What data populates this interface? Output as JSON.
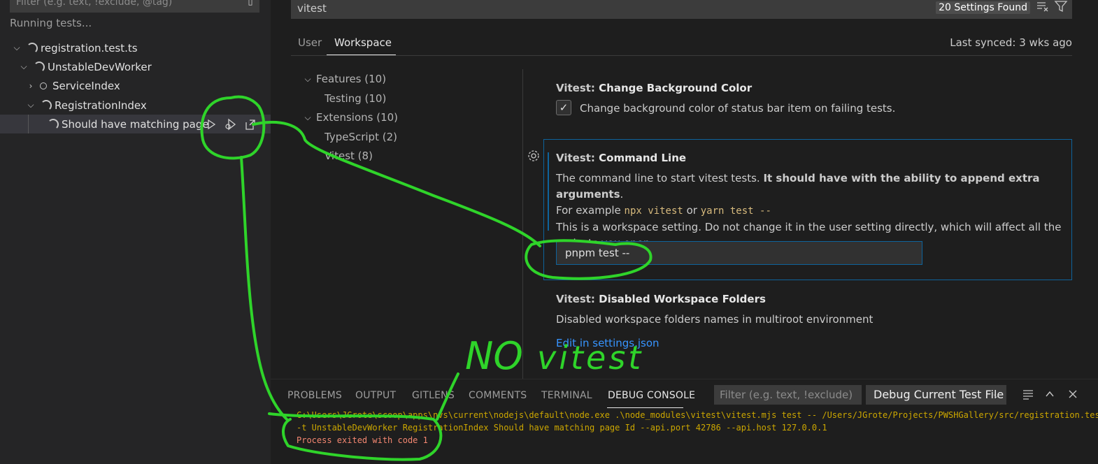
{
  "test_explorer": {
    "filter_placeholder": "Filter (e.g. text, !exclude, @tag)",
    "status": "Running tests...",
    "tree": [
      {
        "label": "registration.test.ts"
      },
      {
        "label": "UnstableDevWorker"
      },
      {
        "label": "ServiceIndex"
      },
      {
        "label": "RegistrationIndex"
      },
      {
        "label": "Should have matching page"
      }
    ],
    "row_actions": [
      "run-test-icon",
      "debug-test-icon",
      "go-to-test-icon"
    ]
  },
  "settings": {
    "search_query": "vitest",
    "found_badge": "20 Settings Found",
    "tabs": [
      {
        "label": "User"
      },
      {
        "label": "Workspace"
      }
    ],
    "active_tab": "Workspace",
    "last_synced": "Last synced: 3 wks ago",
    "toc": [
      {
        "label": "Features (10)"
      },
      {
        "label": "Testing (10)"
      },
      {
        "label": "Extensions (10)"
      },
      {
        "label": "TypeScript (2)"
      },
      {
        "label": "Vitest (8)"
      }
    ],
    "items": [
      {
        "category": "Vitest: ",
        "title": "Change Background Color",
        "checkbox_checked": true,
        "checkbox_label": "Change background color of status bar item on failing tests."
      },
      {
        "category": "Vitest: ",
        "title": "Command Line",
        "desc_plain": "The command line to start vitest tests. ",
        "desc_bold": "It should have with the ability to append extra arguments",
        "desc_end": ".",
        "example_prefix": "For example ",
        "example_code1": "npx vitest",
        "example_or": " or ",
        "example_code2": "yarn test --",
        "note": "This is a workspace setting. Do not change it in the user setting directly, which will affect all the projects you open",
        "value": "pnpm test --"
      },
      {
        "category": "Vitest: ",
        "title": "Disabled Workspace Folders",
        "description": "Disabled workspace folders names in multiroot environment",
        "link": "Edit in settings.json"
      }
    ]
  },
  "panel": {
    "tabs": [
      {
        "label": "PROBLEMS"
      },
      {
        "label": "OUTPUT"
      },
      {
        "label": "GITLENS"
      },
      {
        "label": "COMMENTS"
      },
      {
        "label": "TERMINAL"
      },
      {
        "label": "DEBUG CONSOLE"
      }
    ],
    "active_tab": "DEBUG CONSOLE",
    "filter_placeholder": "Filter (e.g. text, !exclude)",
    "selected_config": "Debug Current Test File",
    "console": [
      "C:\\Users\\JGrote\\scoop\\apps\\nvs\\current\\nodejs\\default\\node.exe .\\node_modules\\vitest\\vitest.mjs test -- /Users/JGrote/Projects/PWSHGallery/src/registration.test.ts",
      "-t UnstableDevWorker RegistrationIndex Should have matching page Id --api.port 42786 --api.host 127.0.0.1",
      "Process exited with code 1"
    ]
  },
  "annotation": {
    "handwritten_text_1": "NO",
    "handwritten_text_2": "vitest",
    "color": "#2fd42a"
  },
  "colors": {
    "accent": "#0e639c",
    "link": "#3794ff",
    "warning": "#cca700",
    "error": "#f48771"
  }
}
